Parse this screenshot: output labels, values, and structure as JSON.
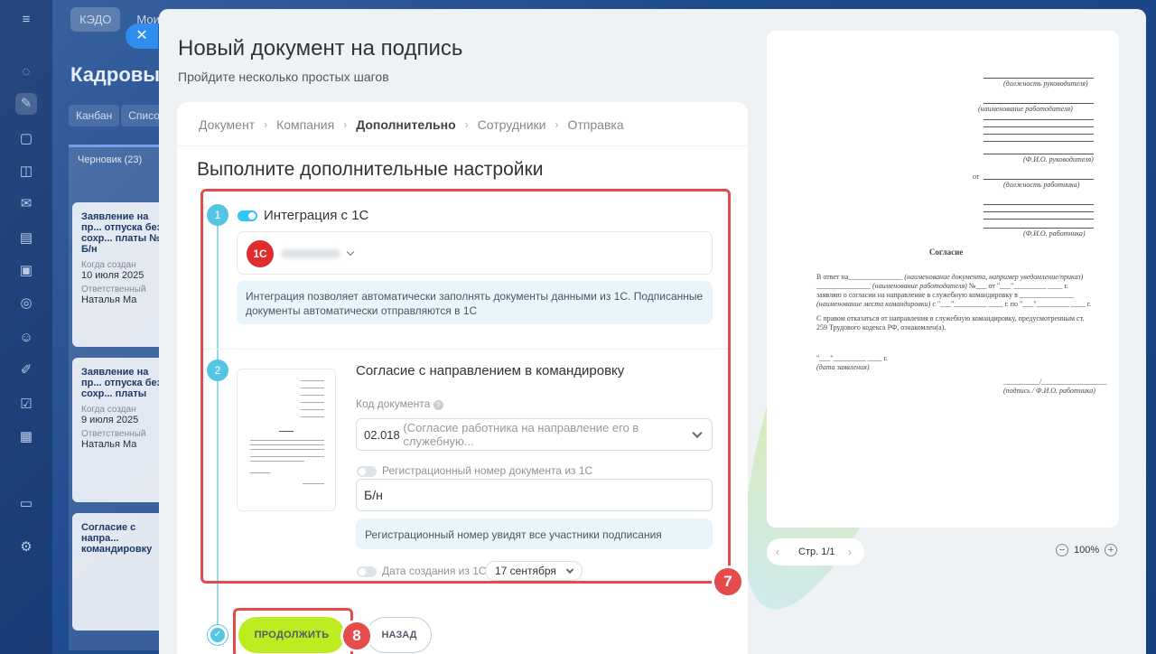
{
  "background": {
    "tabs": [
      "КЭДО",
      "Мои"
    ],
    "title": "Кадровые",
    "view_tabs": [
      "Канбан",
      "Списо"
    ],
    "column": {
      "label": "Черновик",
      "count": "(23)"
    },
    "cards": [
      {
        "title": "Заявление на пр... отпуска без сохр... платы № Б/н",
        "created_label": "Когда создан",
        "date": "10 июля 2025",
        "resp_label": "Ответственный",
        "person": "Наталья Ма"
      },
      {
        "title": "Заявление на пр... отпуска без сохр... платы",
        "created_label": "Когда создан",
        "date": "9 июля 2025",
        "resp_label": "Ответственный",
        "person": "Наталья Ма"
      },
      {
        "title": "Согласие с напра... командировку",
        "created_label": "",
        "date": "",
        "resp_label": "",
        "person": ""
      }
    ]
  },
  "panel": {
    "title": "Новый документ на подпись",
    "subtitle": "Пройдите несколько простых шагов",
    "close_icon": "close-icon"
  },
  "breadcrumb": [
    "Документ",
    "Компания",
    "Дополнительно",
    "Сотрудники",
    "Отправка"
  ],
  "section_title": "Выполните дополнительные настройки",
  "step1": {
    "num": "1",
    "toggle_label": "Интеграция с 1С",
    "toggle_on": true,
    "logo_text": "1С",
    "info": "Интеграция позволяет автоматически заполнять документы данными из 1С. Подписанные документы автоматически отправляются в 1С"
  },
  "step2": {
    "num": "2",
    "doc_title": "Согласие с направлением в командировку",
    "code_label": "Код документа",
    "code_value": "02.018",
    "code_desc": "(Согласие работника на направление его в служебную...",
    "reg_toggle_label": "Регистрационный номер документа из 1С",
    "reg_value": "Б/н",
    "reg_info": "Регистрационный номер увидят все участники подписания",
    "date_toggle_label": "Дата создания из 1С",
    "date_value": "17 сентября"
  },
  "annotations": {
    "frame_badge": "7",
    "button_badge": "8"
  },
  "buttons": {
    "continue": "ПРОДОЛЖИТЬ",
    "back": "НАЗАД"
  },
  "preview": {
    "right_labels": [
      "(должность руководителя)",
      "(наименование работодателя)",
      "(Ф.И.О. руководителя)",
      "(должность работника)",
      "(Ф.И.О. работника)"
    ],
    "from": "от",
    "doc_heading": "Согласие",
    "line1_start": "В ответ на_______________",
    "line1_note": "(наименование документа, например уведомление/приказ)",
    "line2_note": "(наименование работодателя)",
    "line2_end": "№___ от \"___\"_________ ____ г.",
    "line3": "заявляю о согласии на направление в служебную командировку в _______________",
    "line4_note": "(наименование места командировки)",
    "line4_end": "с \"___\"_________ ____ г. по \"___\"_________ ____ г.",
    "para2": "С правом отказаться от направления в служебную командировку, предусмотренным ст. 259 Трудового кодекса РФ, ознакомлен(а).",
    "date_line": "\"___\"_________ ____ г.",
    "date_note": "(дата заявления)",
    "sign_line": "__________/__________________",
    "sign_note": "(подпись / Ф.И.О. работника)"
  },
  "pager": {
    "label": "Стр. 1/1"
  },
  "zoom": {
    "value": "100%",
    "minus": "−",
    "plus": "+"
  }
}
